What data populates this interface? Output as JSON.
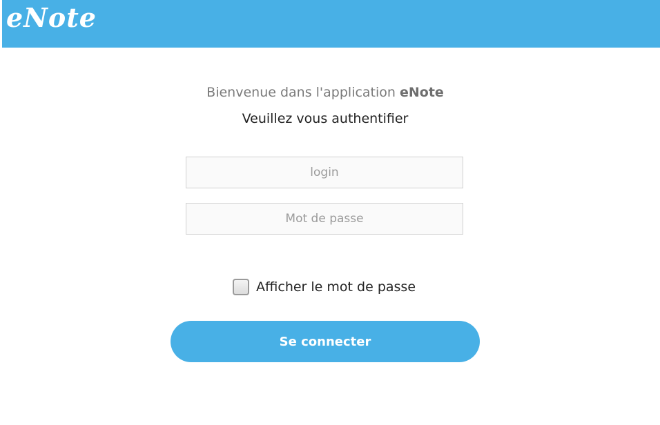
{
  "header": {
    "logo_text": "eNote",
    "background_color": "#48b0e6"
  },
  "welcome": {
    "prefix": "Bienvenue dans l'application ",
    "app_name": "eNote"
  },
  "auth_prompt": "Veuillez vous authentifier",
  "form": {
    "login": {
      "value": "",
      "placeholder": "login"
    },
    "password": {
      "value": "",
      "placeholder": "Mot de passe"
    },
    "show_password": {
      "label": "Afficher le mot de passe",
      "checked": false
    },
    "submit_label": "Se connecter"
  }
}
